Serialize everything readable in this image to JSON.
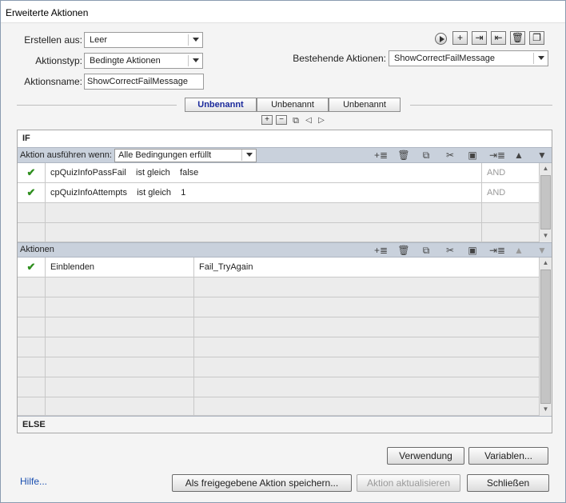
{
  "window": {
    "title": "Erweiterte Aktionen"
  },
  "form": {
    "create_from_label": "Erstellen aus:",
    "create_from_value": "Leer",
    "action_type_label": "Aktionstyp:",
    "action_type_value": "Bedingte Aktionen",
    "action_name_label": "Aktionsname:",
    "action_name_value": "ShowCorrectFailMessage",
    "existing_label": "Bestehende Aktionen:",
    "existing_value": "ShowCorrectFailMessage"
  },
  "toolbar": {
    "plus": "+",
    "minus": "−"
  },
  "tabs": [
    {
      "label": "Unbenannt"
    },
    {
      "label": "Unbenannt"
    },
    {
      "label": "Unbenannt"
    }
  ],
  "if_section": {
    "header": "IF",
    "cond_label": "Aktion ausführen wenn:",
    "cond_value": "Alle Bedingungen erfüllt",
    "rows": [
      {
        "var": "cpQuizInfoPassFail",
        "op": "ist gleich",
        "value": "false",
        "logic": "AND"
      },
      {
        "var": "cpQuizInfoAttempts",
        "op": "ist gleich",
        "value": "1",
        "logic": "AND"
      }
    ]
  },
  "actions_section": {
    "header": "Aktionen",
    "rows": [
      {
        "action": "Einblenden",
        "target": "Fail_TryAgain"
      }
    ]
  },
  "else_section": {
    "header": "ELSE"
  },
  "buttons": {
    "usage": "Verwendung",
    "variables": "Variablen...",
    "save_shared": "Als freigegebene Aktion speichern...",
    "update": "Aktion aktualisieren",
    "close": "Schließen"
  },
  "help_link": "Hilfe...",
  "colors": {
    "check": "#2f8f1f",
    "active_tab": "#1b2a9c",
    "link": "#1a4fb0",
    "section_bar": "#c9d1dc"
  }
}
